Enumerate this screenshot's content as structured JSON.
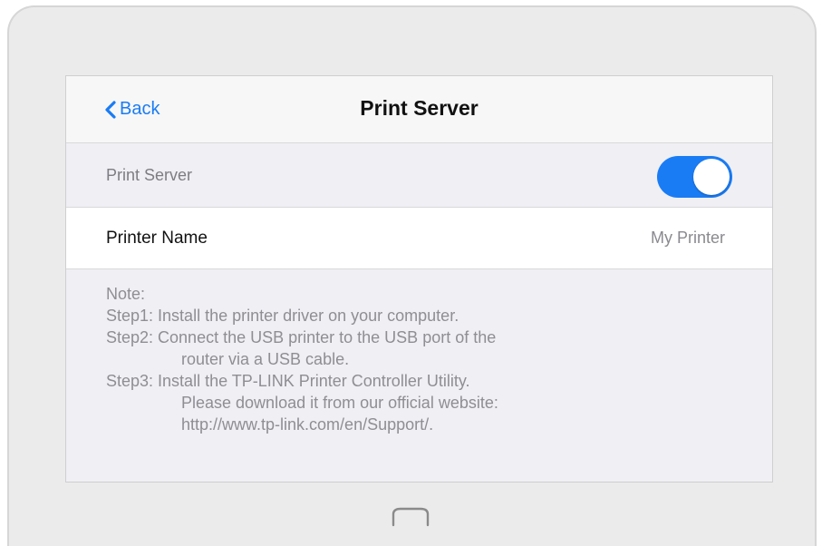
{
  "navbar": {
    "back_label": "Back",
    "title": "Print Server"
  },
  "settings": {
    "print_server_label": "Print Server",
    "print_server_enabled": true,
    "printer_name_label": "Printer Name",
    "printer_name_value": "My Printer"
  },
  "note": {
    "heading": "Note:",
    "step1": "Step1: Install the printer driver on your computer.",
    "step2_a": "Step2: Connect the USB printer to the USB port of the",
    "step2_b": "router via a USB cable.",
    "step3_a": "Step3: Install the TP-LINK Printer Controller Utility.",
    "step3_b": "Please download it from our official website:",
    "step3_c": "http://www.tp-link.com/en/Support/."
  },
  "colors": {
    "accent": "#1a7cf4",
    "device_frame": "#ebebeb",
    "screen_bg": "#efeff4"
  },
  "icons": {
    "back": "chevron-left-icon",
    "home": "home-button-icon"
  }
}
